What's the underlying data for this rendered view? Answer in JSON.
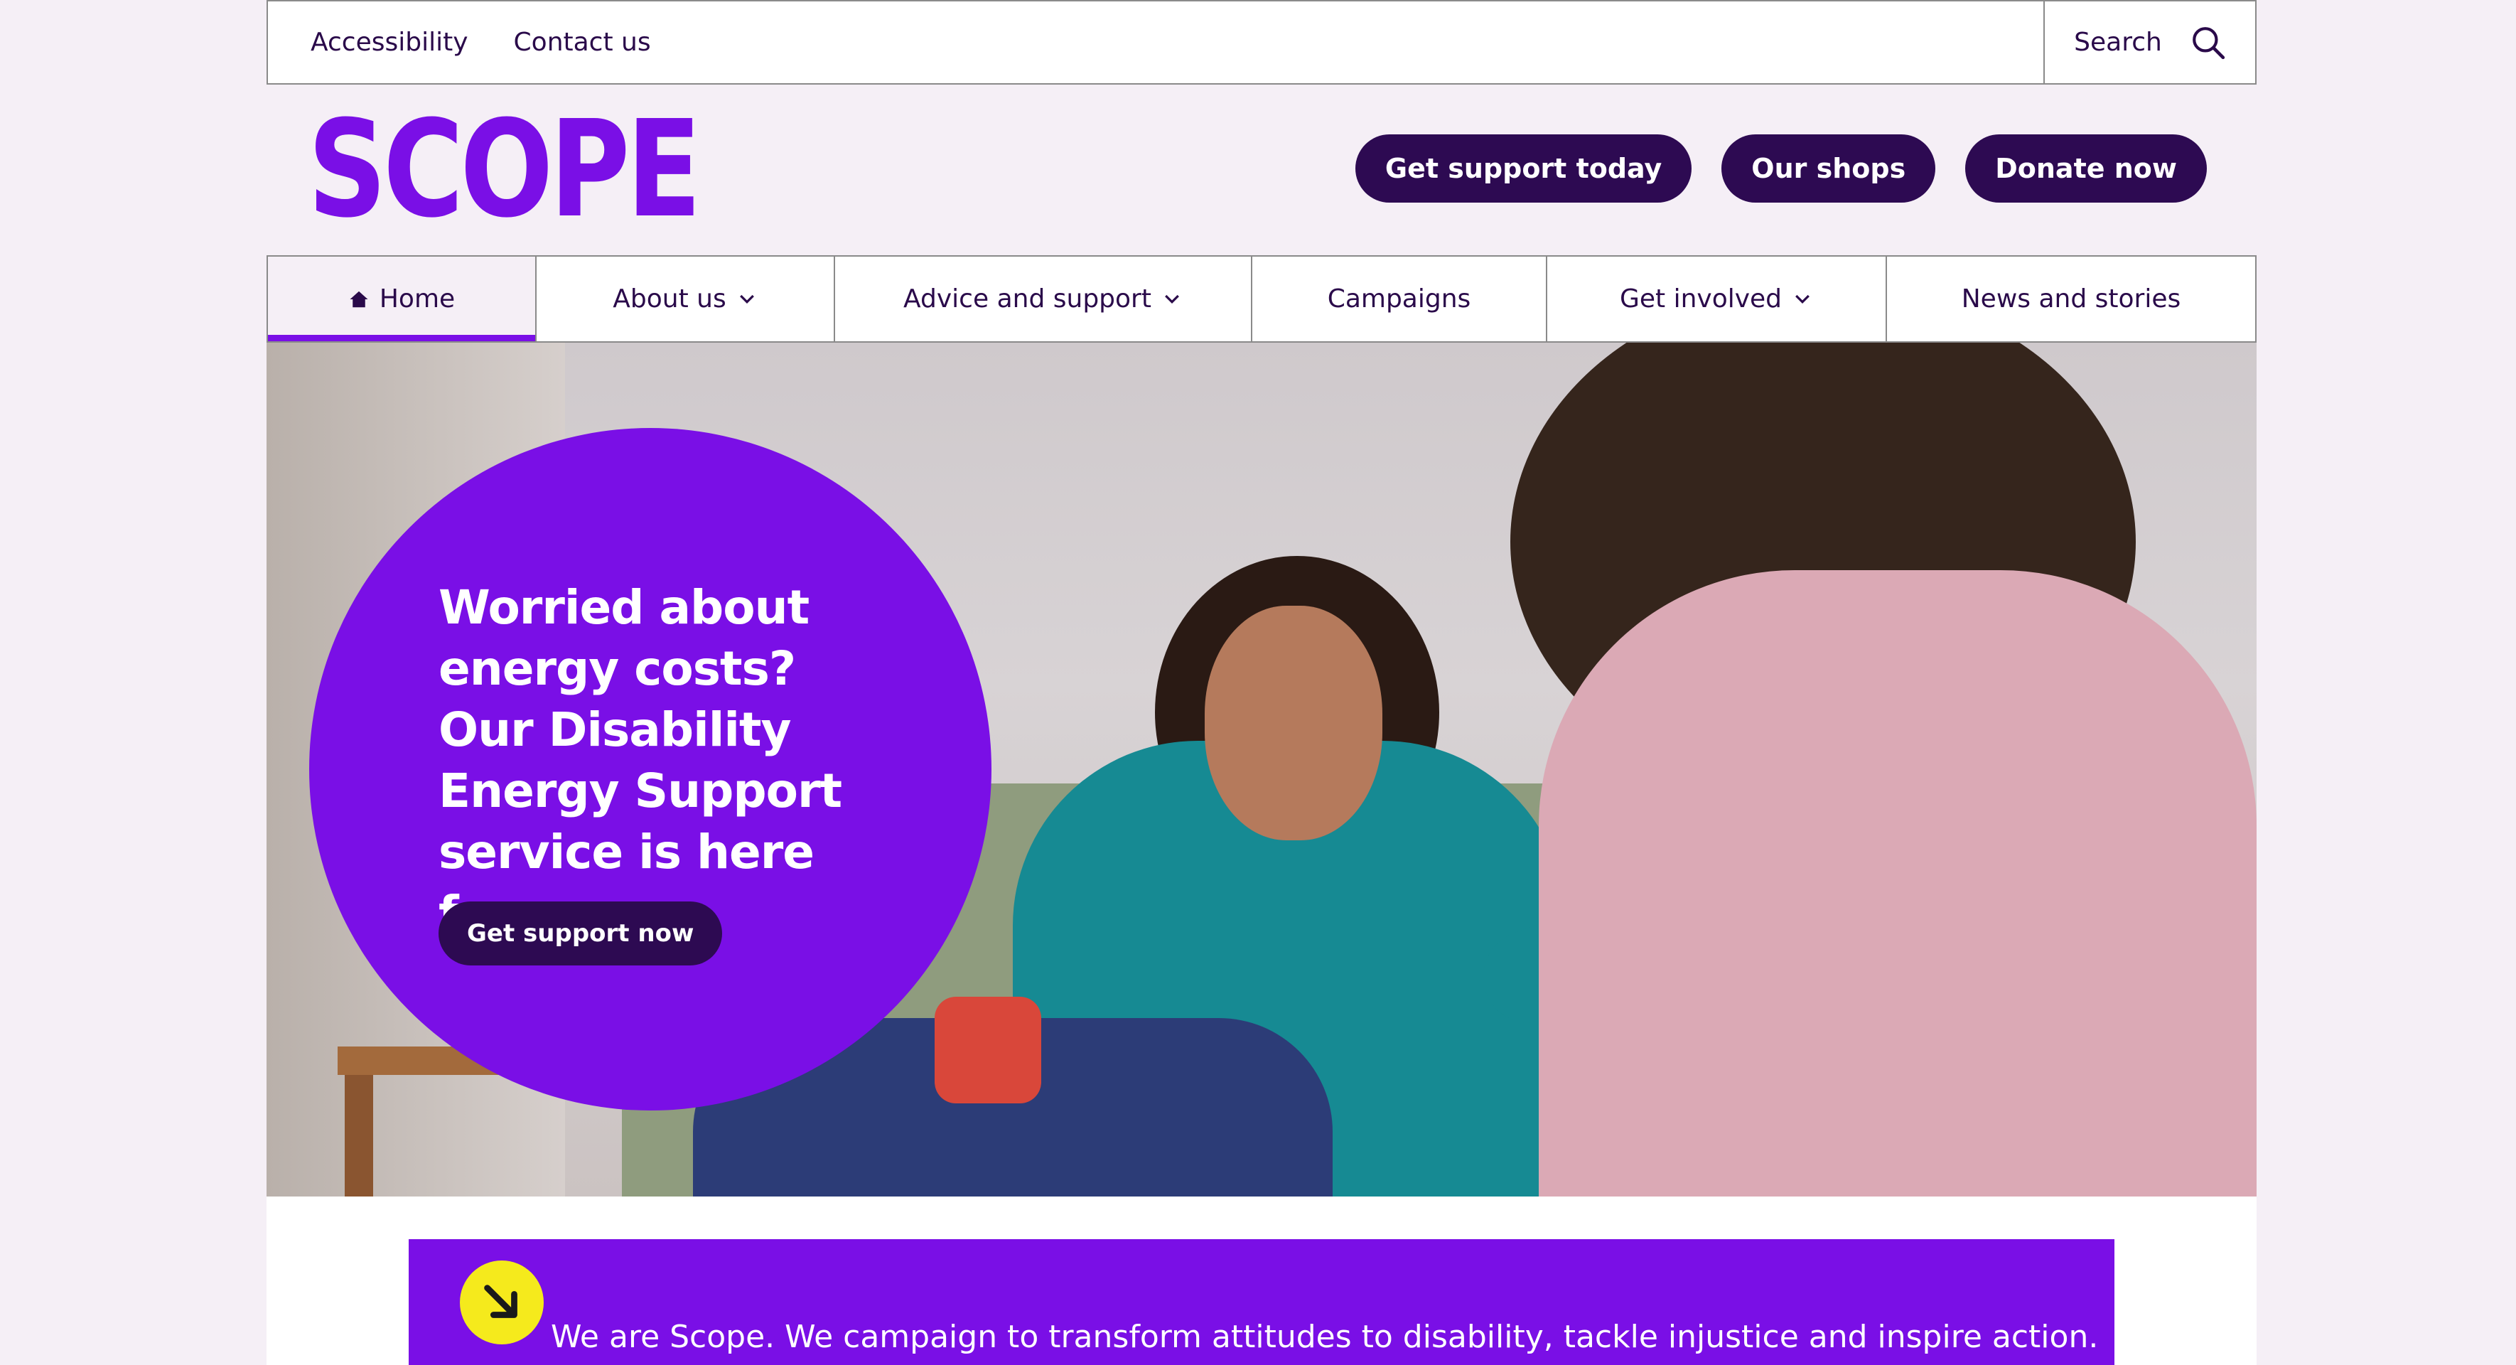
{
  "utility": {
    "links": [
      "Accessibility",
      "Contact us"
    ],
    "search_label": "Search"
  },
  "header": {
    "logo": "SCOPE",
    "buttons": [
      "Get support today",
      "Our shops",
      "Donate now"
    ]
  },
  "nav": {
    "items": [
      {
        "label": "Home",
        "icon": "home-icon",
        "active": true
      },
      {
        "label": "About us",
        "dropdown": true
      },
      {
        "label": "Advice and support",
        "dropdown": true
      },
      {
        "label": "Campaigns"
      },
      {
        "label": "Get involved",
        "dropdown": true
      },
      {
        "label": "News and stories"
      }
    ]
  },
  "hero": {
    "headline": "Worried about energy costs? Our Disability Energy Support service is here for you.",
    "cta": "Get support now"
  },
  "banner": {
    "icon": "arrow-down-right-icon",
    "text": "We are Scope. We campaign to transform attitudes to disability, tackle injustice and inspire action."
  },
  "colors": {
    "brand_purple": "#7a0fe6",
    "dark_purple": "#2d0a52",
    "background": "#f5eff6",
    "accent_yellow": "#f5ea1c"
  }
}
